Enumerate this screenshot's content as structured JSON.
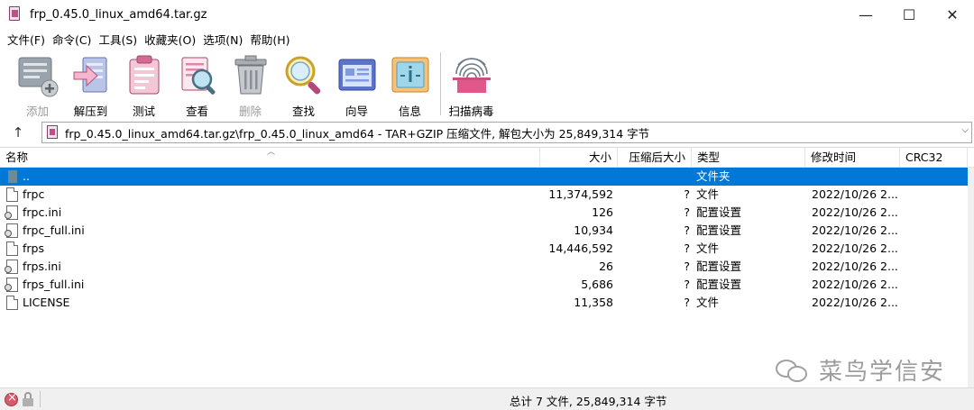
{
  "window": {
    "title": "frp_0.45.0_linux_amd64.tar.gz",
    "minimize": "—",
    "maximize": "☐",
    "close": "✕"
  },
  "menu": [
    "文件(F)",
    "命令(C)",
    "工具(S)",
    "收藏夹(O)",
    "选项(N)",
    "帮助(H)"
  ],
  "toolbar": {
    "buttons": [
      {
        "label": "添加",
        "icon": "add-archive-icon",
        "disabled": true
      },
      {
        "label": "解压到",
        "icon": "extract-to-icon",
        "disabled": false
      },
      {
        "label": "测试",
        "icon": "test-clipboard-icon",
        "disabled": false
      },
      {
        "label": "查看",
        "icon": "view-magnifier-icon",
        "disabled": false
      },
      {
        "label": "删除",
        "icon": "delete-trash-icon",
        "disabled": true
      },
      {
        "label": "查找",
        "icon": "find-magnifier-icon",
        "disabled": false
      },
      {
        "label": "向导",
        "icon": "wizard-icon",
        "disabled": false
      },
      {
        "label": "信息",
        "icon": "info-icon",
        "disabled": false
      },
      {
        "label": "扫描病毒",
        "icon": "virus-scan-icon",
        "disabled": false
      }
    ]
  },
  "address": {
    "up_arrow": "↑",
    "path": "frp_0.45.0_linux_amd64.tar.gz\\frp_0.45.0_linux_amd64 - TAR+GZIP 压缩文件, 解包大小为 25,849,314 字节",
    "dropdown": "⌵"
  },
  "columns": {
    "name": "名称",
    "size": "大小",
    "packed": "压缩后大小",
    "type": "类型",
    "modified": "修改时间",
    "crc": "CRC32"
  },
  "rows": [
    {
      "name": "..",
      "size": "",
      "packed": "",
      "type": "文件夹",
      "modified": "",
      "icon": "folder",
      "selected": true
    },
    {
      "name": "frpc",
      "size": "11,374,592",
      "packed": "?",
      "type": "文件",
      "modified": "2022/10/26 2...",
      "icon": "doc",
      "selected": false
    },
    {
      "name": "frpc.ini",
      "size": "126",
      "packed": "?",
      "type": "配置设置",
      "modified": "2022/10/26 2...",
      "icon": "ini",
      "selected": false
    },
    {
      "name": "frpc_full.ini",
      "size": "10,934",
      "packed": "?",
      "type": "配置设置",
      "modified": "2022/10/26 2...",
      "icon": "ini",
      "selected": false
    },
    {
      "name": "frps",
      "size": "14,446,592",
      "packed": "?",
      "type": "文件",
      "modified": "2022/10/26 2...",
      "icon": "doc",
      "selected": false
    },
    {
      "name": "frps.ini",
      "size": "26",
      "packed": "?",
      "type": "配置设置",
      "modified": "2022/10/26 2...",
      "icon": "ini",
      "selected": false
    },
    {
      "name": "frps_full.ini",
      "size": "5,686",
      "packed": "?",
      "type": "配置设置",
      "modified": "2022/10/26 2...",
      "icon": "ini",
      "selected": false
    },
    {
      "name": "LICENSE",
      "size": "11,358",
      "packed": "?",
      "type": "文件",
      "modified": "2022/10/26 2...",
      "icon": "doc",
      "selected": false
    }
  ],
  "watermark": "菜鸟学信安",
  "status": {
    "summary": "总计 7 文件, 25,849,314 字节"
  }
}
